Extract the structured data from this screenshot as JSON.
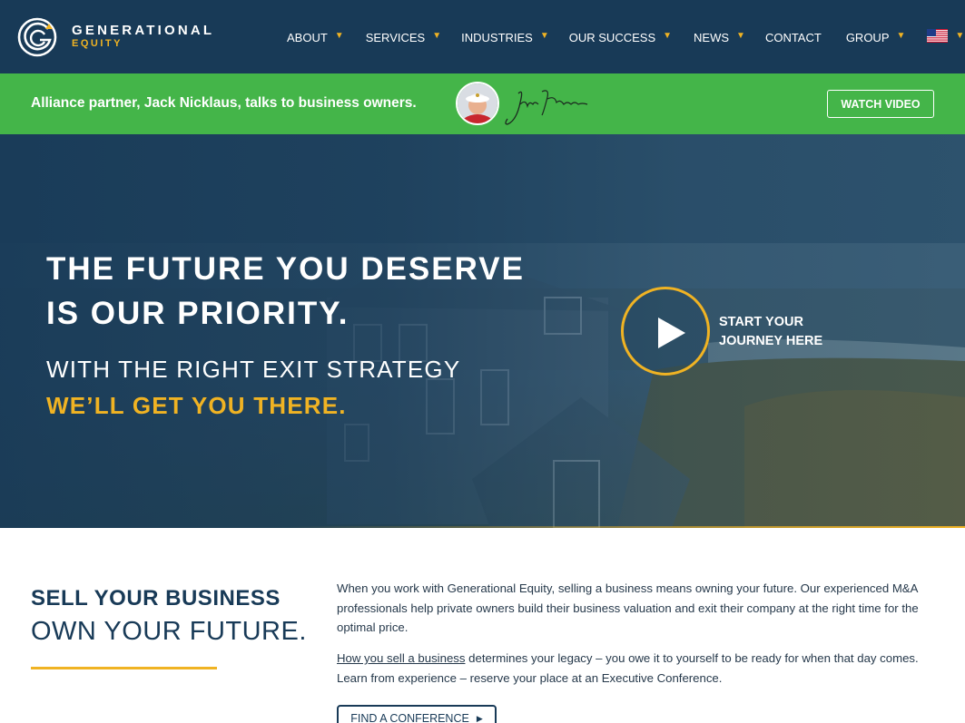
{
  "nav": {
    "logo": {
      "line1": "GENERATIONAL",
      "line2": "EQUITY"
    },
    "items": [
      {
        "label": "ABOUT",
        "caret": true
      },
      {
        "label": "SERVICES",
        "caret": true
      },
      {
        "label": "INDUSTRIES",
        "caret": true
      },
      {
        "label": "OUR SUCCESS",
        "caret": true
      },
      {
        "label": "NEWS",
        "caret": true
      },
      {
        "label": "CONTACT",
        "caret": false
      },
      {
        "label": "GROUP",
        "caret": true
      }
    ],
    "caret_glyph": "▼",
    "language_flag": "us-flag-icon"
  },
  "banner": {
    "text": "Alliance partner, Jack Nicklaus, talks to business owners.",
    "watch_label": "WATCH VIDEO"
  },
  "hero": {
    "title_line1": "THE FUTURE YOU DESERVE",
    "title_line2": "IS OUR PRIORITY.",
    "sub_line1": "WITH THE RIGHT EXIT STRATEGY",
    "sub_line2": "WE’LL GET YOU THERE.",
    "journey_line1": "START YOUR",
    "journey_line2": "JOURNEY HERE"
  },
  "content": {
    "heading1": "SELL YOUR BUSINESS",
    "heading2": "OWN YOUR FUTURE.",
    "para1": "When you work with Generational Equity, selling a business means owning your future. Our experienced M&A professionals help private owners build their business valuation and exit their company at the right time for the optimal price.",
    "para2_link": "How you sell a business",
    "para2_rest": " determines your legacy – you owe it to yourself to be ready for when that day comes. Learn from experience – reserve your place at an Executive Conference.",
    "conference_label": "FIND A CONFERENCE",
    "conference_arrow": "▶"
  },
  "colors": {
    "navy": "#183a57",
    "gold": "#f0b323",
    "green": "#44b549"
  }
}
